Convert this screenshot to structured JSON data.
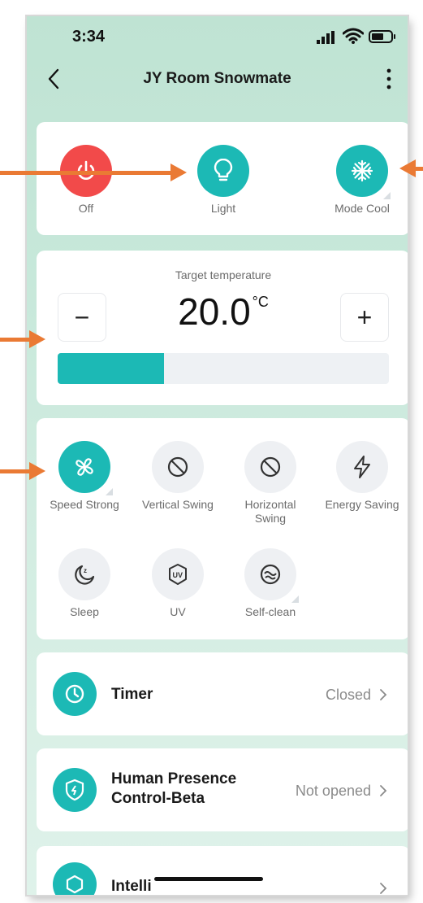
{
  "status": {
    "time": "3:34"
  },
  "header": {
    "title": "JY Room Snowmate"
  },
  "controls": {
    "off_label": "Off",
    "light_label": "Light",
    "mode_label": "Mode Cool"
  },
  "temperature": {
    "label": "Target temperature",
    "value": "20.0",
    "unit": "°C",
    "minus": "−",
    "plus": "+",
    "level_fraction": 0.32
  },
  "functions": [
    {
      "label": "Speed Strong",
      "icon": "fan-icon",
      "active": true
    },
    {
      "label": "Vertical Swing",
      "icon": "no-icon",
      "active": false
    },
    {
      "label": "Horizontal Swing",
      "icon": "no-icon",
      "active": false
    },
    {
      "label": "Energy Saving",
      "icon": "bolt-icon",
      "active": false
    },
    {
      "label": "Sleep",
      "icon": "moon-icon",
      "active": false
    },
    {
      "label": "UV",
      "icon": "uv-icon",
      "active": false
    },
    {
      "label": "Self-clean",
      "icon": "self-clean-icon",
      "active": false
    }
  ],
  "rows": {
    "timer": {
      "title": "Timer",
      "value": "Closed"
    },
    "presence": {
      "title": "Human Presence Control-Beta",
      "value": "Not opened"
    },
    "intelligent": {
      "title": "Intelli"
    }
  },
  "colors": {
    "accent": "#1cb9b5",
    "power": "#f24a4a",
    "annotation_arrow": "#ea7a34"
  }
}
